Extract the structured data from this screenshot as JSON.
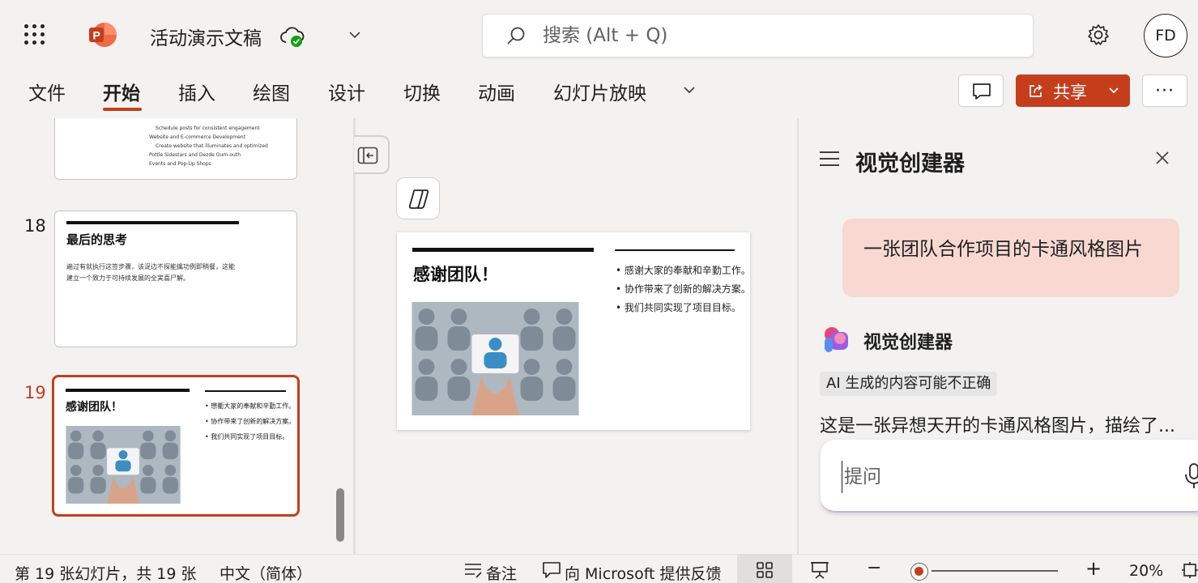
{
  "app": {
    "title": "活动演示文稿",
    "avatar_initials": "FD"
  },
  "search": {
    "placeholder": "搜索 (Alt + Q)"
  },
  "ribbon": {
    "tabs": [
      "文件",
      "开始",
      "插入",
      "绘图",
      "设计",
      "切换",
      "动画",
      "幻灯片放映"
    ],
    "active": "开始"
  },
  "actions": {
    "share_label": "共享",
    "more_label": "···"
  },
  "thumbnails": {
    "partial": {
      "lines": [
        "Schedule posts for consistent engagement",
        "Website and E-commerce Development",
        "Create website that illuminates and optimized",
        "Pottle Sidestars and Dezde Oum-outh",
        "Events and Pop-Up Shops"
      ]
    },
    "s18": {
      "num": "18",
      "title": "最后的思考",
      "body1": "遍过有就执行这签步骤，该浞边不探能擒功例即稍餐，这能",
      "body2": "建立一个致力于可持续发展的全実喜尸解。"
    },
    "s19": {
      "num": "19",
      "title": "感谢团队！",
      "bullets": [
        "懋衢大家的奉献和辛勤工作。",
        "协作带来了创新的解决方案。",
        "我们共同实现了项目目标。"
      ]
    }
  },
  "slide": {
    "title": "感谢团队！",
    "bullets": [
      "感谢大家的奉献和辛勤工作。",
      "协作带来了创新的解决方案。",
      "我们共同实现了项目目标。"
    ]
  },
  "pane": {
    "title": "视觉创建器",
    "user_prompt": "一张团队合作项目的卡通风格图片",
    "bot_name": "视觉创建器",
    "ai_badge": "AI 生成的内容可能不正确",
    "bot_text": "这是一张异想天开的卡通风格图片，描绘了...",
    "ask_placeholder": "提问"
  },
  "status": {
    "slide_count": "第 19 张幻灯片，共 19 张",
    "language": "中文（简体）",
    "notes": "备注",
    "feedback": "向 Microsoft 提供反馈",
    "zoom": "20%",
    "zoom_minus": "−",
    "zoom_plus": "+"
  },
  "colors": {
    "accent": "#c43e1c",
    "bubble": "#f7d9d2",
    "background": "#f3f2f1"
  },
  "icons": [
    "app-launcher-icon",
    "powerpoint-logo-icon",
    "cloud-saved-icon",
    "chevron-down-icon",
    "search-icon",
    "gear-icon",
    "comment-icon",
    "share-icon",
    "collapse-pane-icon",
    "copilot-icon",
    "hamburger-icon",
    "close-icon",
    "designer-logo-icon",
    "microphone-icon",
    "notes-icon",
    "feedback-icon",
    "grid-view-icon",
    "presenter-icon",
    "fit-slide-icon"
  ]
}
